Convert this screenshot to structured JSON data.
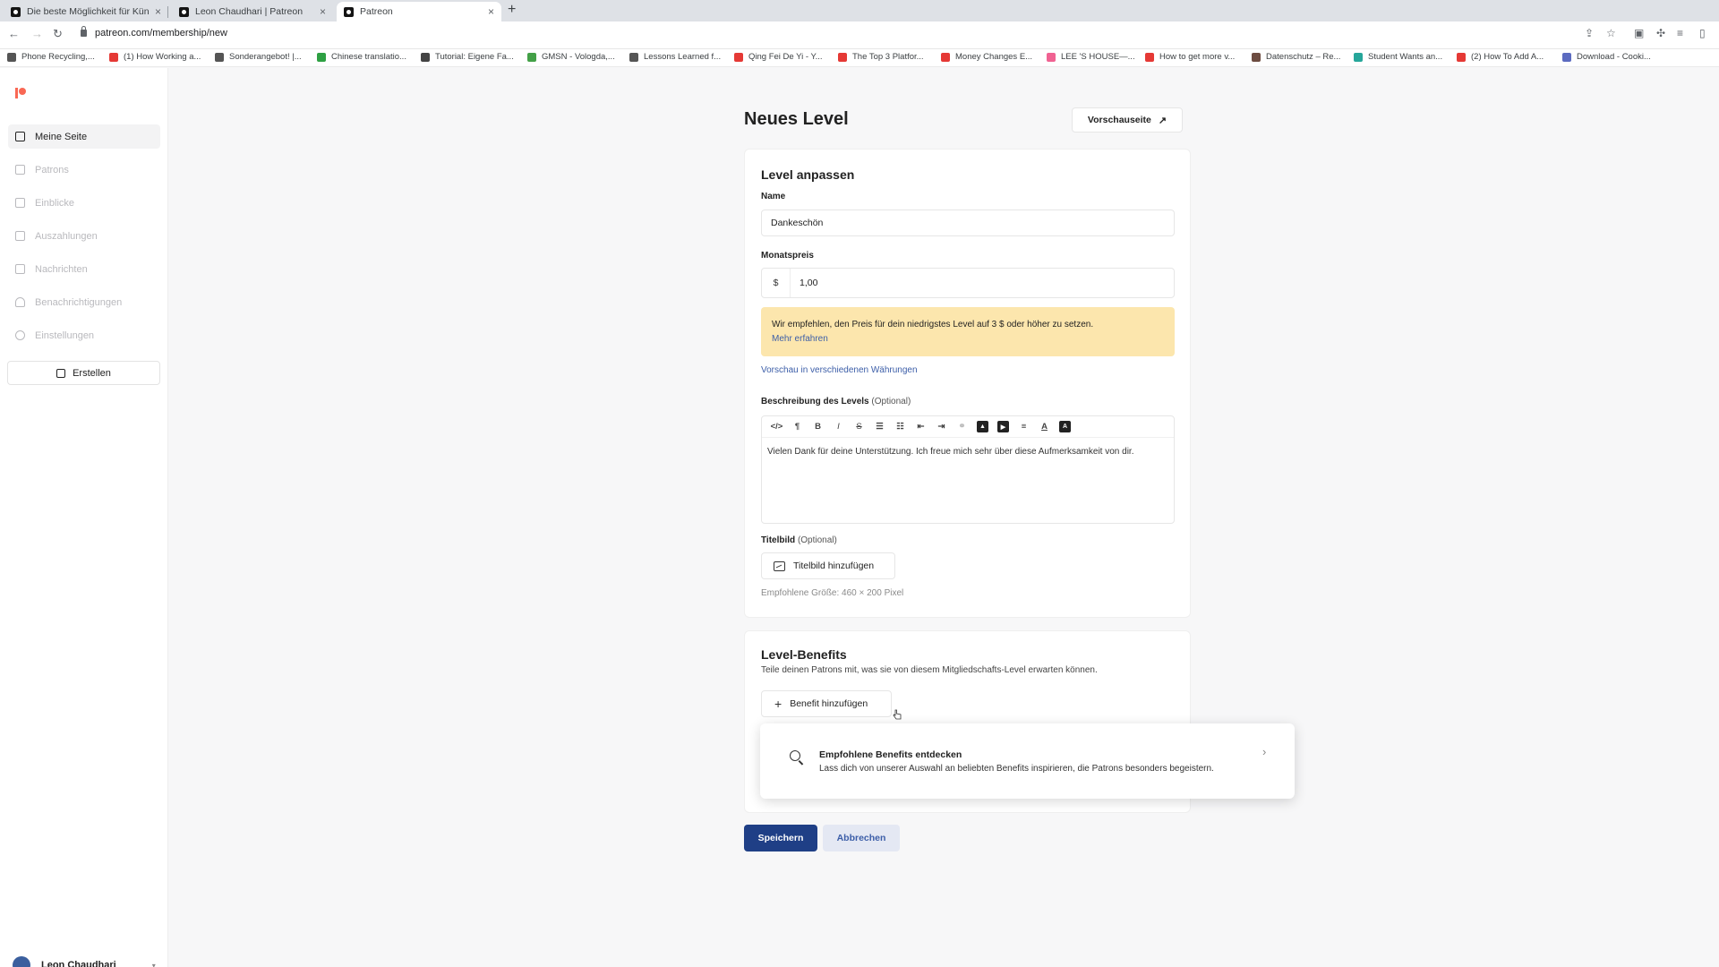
{
  "browser": {
    "tabs": [
      {
        "title": "Die beste Möglichkeit für Küns"
      },
      {
        "title": "Leon Chaudhari | Patreon"
      },
      {
        "title": "Patreon"
      }
    ],
    "url": "patreon.com/membership/new",
    "bookmarks": [
      {
        "label": "Phone Recycling,...",
        "color": "#555555"
      },
      {
        "label": "(1) How Working a...",
        "color": "#e53935"
      },
      {
        "label": "Sonderangebot! |...",
        "color": "#555555"
      },
      {
        "label": "Chinese translatio...",
        "color": "#2ea043"
      },
      {
        "label": "Tutorial: Eigene Fa...",
        "color": "#444444"
      },
      {
        "label": "GMSN - Vologda,...",
        "color": "#43a047"
      },
      {
        "label": "Lessons Learned f...",
        "color": "#555555"
      },
      {
        "label": "Qing Fei De Yi - Y...",
        "color": "#e53935"
      },
      {
        "label": "The Top 3 Platfor...",
        "color": "#e53935"
      },
      {
        "label": "Money Changes E...",
        "color": "#e53935"
      },
      {
        "label": "LEE 'S HOUSE—...",
        "color": "#f06292"
      },
      {
        "label": "How to get more v...",
        "color": "#e53935"
      },
      {
        "label": "Datenschutz – Re...",
        "color": "#6d4c41"
      },
      {
        "label": "Student Wants an...",
        "color": "#26a69a"
      },
      {
        "label": "(2) How To Add A...",
        "color": "#e53935"
      },
      {
        "label": "Download - Cooki...",
        "color": "#5c6bc0"
      }
    ]
  },
  "sidebar": {
    "items": [
      {
        "label": "Meine Seite",
        "icon": "home-icon"
      },
      {
        "label": "Patrons",
        "icon": "people-icon"
      },
      {
        "label": "Einblicke",
        "icon": "chart-icon"
      },
      {
        "label": "Auszahlungen",
        "icon": "wallet-icon"
      },
      {
        "label": "Nachrichten",
        "icon": "mail-icon"
      },
      {
        "label": "Benachrichtigungen",
        "icon": "bell-icon"
      },
      {
        "label": "Einstellungen",
        "icon": "gear-icon"
      }
    ],
    "create_label": "Erstellen",
    "user_name": "Leon Chaudhari"
  },
  "header": {
    "title": "Neues Level",
    "preview_label": "Vorschauseite"
  },
  "level": {
    "section_title": "Level anpassen",
    "name_label": "Name",
    "name_value": "Dankeschön",
    "price_label": "Monatspreis",
    "currency_symbol": "$",
    "price_value": "1,00",
    "warning_text": "Wir empfehlen, den Preis für dein niedrigstes Level auf 3 $ oder höher zu setzen.",
    "warning_link": "Mehr erfahren",
    "currency_preview_link": "Vorschau in verschiedenen Währungen",
    "description_label": "Beschreibung des Levels",
    "description_optional": "(Optional)",
    "description_text": "Vielen Dank für deine Unterstützung. Ich freue mich sehr über diese Aufmerksamkeit von dir.",
    "image_label": "Titelbild",
    "image_optional": "(Optional)",
    "image_button": "Titelbild hinzufügen",
    "image_hint": "Empfohlene Größe: 460 × 200 Pixel"
  },
  "benefits": {
    "title": "Level-Benefits",
    "description": "Teile deinen Patrons mit, was sie von diesem Mitgliedschafts-Level erwarten können.",
    "add_button": "Benefit hinzufügen",
    "popover_title": "Empfohlene Benefits entdecken",
    "popover_text": "Lass dich von unserer Auswahl an beliebten Benefits inspirieren, die Patrons besonders begeistern."
  },
  "actions": {
    "save_label": "Speichern",
    "cancel_label": "Abbrechen"
  },
  "colors": {
    "brand": "#f96854",
    "primary": "#1f3f86",
    "link": "#3c5ea8",
    "warning_bg": "#fce6ad"
  }
}
